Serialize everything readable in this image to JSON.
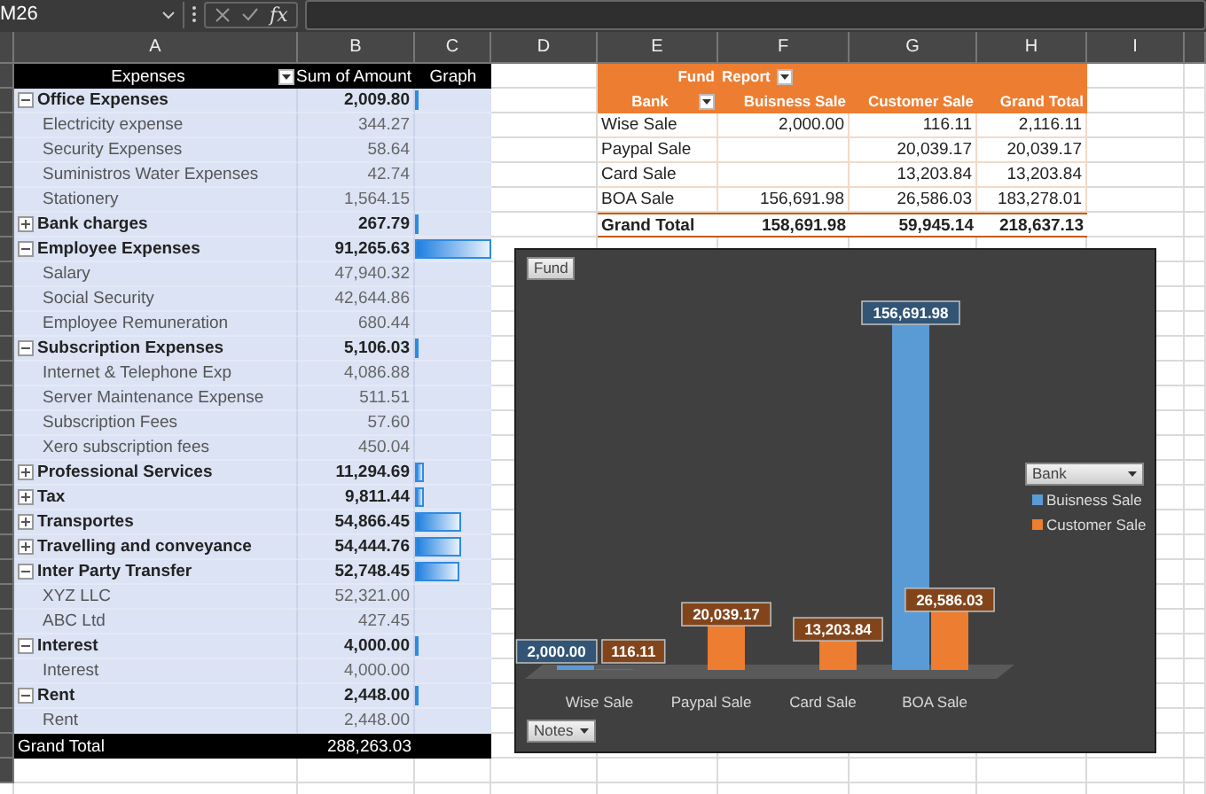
{
  "formula_bar": {
    "name_box": "M26",
    "function_label": "fx"
  },
  "column_headers": [
    "A",
    "B",
    "C",
    "D",
    "E",
    "F",
    "G",
    "H",
    "I"
  ],
  "expenses": {
    "header": {
      "label": "Expenses",
      "value": "Sum of Amount",
      "graph": "Graph"
    },
    "groups": [
      {
        "label": "Office Expenses",
        "amount": "2,009.80",
        "expanded": true,
        "level": 0.022,
        "children": [
          {
            "label": "Electricity expense",
            "amount": "344.27"
          },
          {
            "label": "Security  Expenses",
            "amount": "58.64"
          },
          {
            "label": "Suministros Water Expenses",
            "amount": "42.74"
          },
          {
            "label": "Stationery",
            "amount": "1,564.15"
          }
        ]
      },
      {
        "label": "Bank charges",
        "amount": "267.79",
        "expanded": false,
        "level": 0.003
      },
      {
        "label": "Employee Expenses",
        "amount": "91,265.63",
        "expanded": true,
        "level": 1.0,
        "children": [
          {
            "label": "Salary",
            "amount": "47,940.32"
          },
          {
            "label": "Social Security",
            "amount": "42,644.86"
          },
          {
            "label": "Employee Remuneration",
            "amount": "680.44"
          }
        ]
      },
      {
        "label": "Subscription Expenses",
        "amount": "5,106.03",
        "expanded": true,
        "level": 0.056,
        "children": [
          {
            "label": "Internet & Telephone Exp",
            "amount": "4,086.88"
          },
          {
            "label": "Server Maintenance Expense",
            "amount": "511.51"
          },
          {
            "label": "Subscription Fees",
            "amount": "57.60"
          },
          {
            "label": "Xero subscription fees",
            "amount": "450.04"
          }
        ]
      },
      {
        "label": "Professional Services",
        "amount": "11,294.69",
        "expanded": false,
        "level": 0.124
      },
      {
        "label": "Tax",
        "amount": "9,811.44",
        "expanded": false,
        "level": 0.108
      },
      {
        "label": "Transportes",
        "amount": "54,866.45",
        "expanded": false,
        "level": 0.601
      },
      {
        "label": "Travelling and conveyance",
        "amount": "54,444.76",
        "expanded": false,
        "level": 0.597
      },
      {
        "label": "Inter Party Transfer",
        "amount": "52,748.45",
        "expanded": true,
        "level": 0.578,
        "children": [
          {
            "label": "XYZ LLC",
            "amount": "52,321.00"
          },
          {
            "label": "ABC Ltd",
            "amount": "427.45"
          }
        ]
      },
      {
        "label": "Interest",
        "amount": "4,000.00",
        "expanded": true,
        "level": 0.044,
        "children": [
          {
            "label": "Interest",
            "amount": "4,000.00"
          }
        ]
      },
      {
        "label": "Rent",
        "amount": "2,448.00",
        "expanded": true,
        "level": 0.027,
        "children": [
          {
            "label": "Rent",
            "amount": "2,448.00"
          }
        ]
      }
    ],
    "grand_total": {
      "label": "Grand Total",
      "amount": "288,263.03"
    }
  },
  "fund_report": {
    "filter": {
      "field": "Fund",
      "value": "Report"
    },
    "row_field": "Bank",
    "columns": [
      "Buisness Sale",
      "Customer Sale",
      "Grand Total"
    ],
    "rows": [
      {
        "bank": "Wise Sale",
        "business_sale": "2,000.00",
        "customer_sale": "116.11",
        "grand_total": "2,116.11"
      },
      {
        "bank": "Paypal Sale",
        "customer_sale": "20,039.17",
        "grand_total": "20,039.17"
      },
      {
        "bank": "Card Sale",
        "customer_sale": "13,203.84",
        "grand_total": "13,203.84"
      },
      {
        "bank": "BOA Sale",
        "business_sale": "156,691.98",
        "customer_sale": "26,586.03",
        "grand_total": "183,278.01"
      }
    ],
    "grand_total": {
      "label": "Grand Total",
      "values": [
        "158,691.98",
        "59,945.14",
        "218,637.13"
      ]
    }
  },
  "chart": {
    "filter_button": "Fund",
    "axis_button": "Notes",
    "legend_button": "Bank",
    "chart_data": {
      "type": "bar",
      "categories": [
        "Wise Sale",
        "Paypal Sale",
        "Card Sale",
        "BOA Sale"
      ],
      "series": [
        {
          "name": "Buisness Sale",
          "color": "#5b9bd5",
          "values": [
            2000,
            null,
            null,
            156691.98
          ],
          "value_labels": [
            "2,000.00",
            null,
            null,
            "156,691.98"
          ]
        },
        {
          "name": "Customer Sale",
          "color": "#ed7d31",
          "values": [
            116.11,
            20039.17,
            13203.84,
            26586.03
          ],
          "value_labels": [
            "116.11",
            "20,039.17",
            "13,203.84",
            "26,586.03"
          ]
        }
      ]
    }
  }
}
